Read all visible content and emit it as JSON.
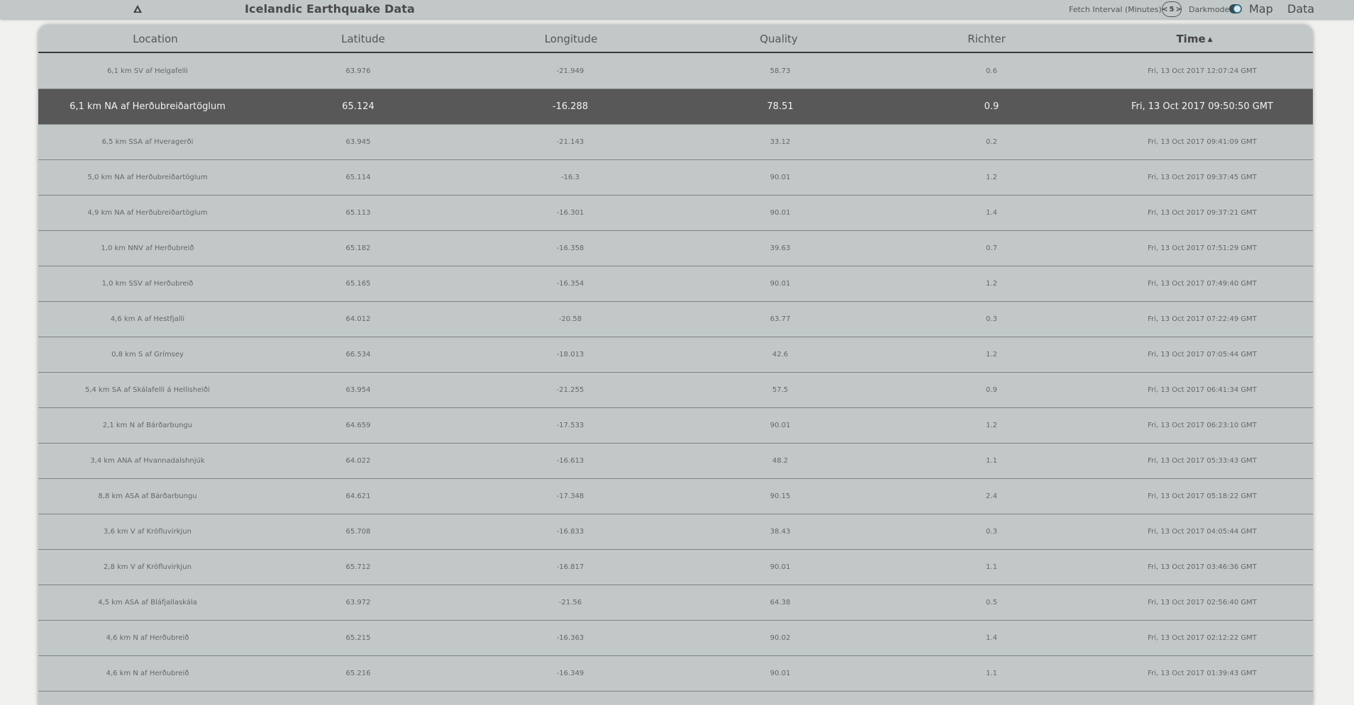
{
  "header": {
    "logo_icon": "warning-triangle-icon",
    "title": "Icelandic Earthquake Data",
    "fetch_interval_label": "Fetch Interval (Minutes)",
    "fetch_interval_value": "5",
    "fetch_interval_decrement": "<",
    "fetch_interval_increment": ">",
    "darkmode_label": "Darkmode",
    "darkmode_on": true,
    "nav_map": "Map",
    "nav_data": "Data"
  },
  "table": {
    "columns": [
      "Location",
      "Latitude",
      "Longitude",
      "Quality",
      "Richter",
      "Time"
    ],
    "sorted_column": "Time",
    "sort_direction": "ascending",
    "selected_row_index": 1,
    "rows": [
      [
        "6,1 km SV af Helgafelli",
        "63.976",
        "-21.949",
        "58.73",
        "0.6",
        "Fri, 13 Oct 2017 12:07:24 GMT"
      ],
      [
        "6,1 km NA af Herðubreiðartöglum",
        "65.124",
        "-16.288",
        "78.51",
        "0.9",
        "Fri, 13 Oct 2017 09:50:50 GMT"
      ],
      [
        "6,5 km SSA af Hveragerði",
        "63.945",
        "-21.143",
        "33.12",
        "0.2",
        "Fri, 13 Oct 2017 09:41:09 GMT"
      ],
      [
        "5,0 km NA af Herðubreiðartöglum",
        "65.114",
        "-16.3",
        "90.01",
        "1.2",
        "Fri, 13 Oct 2017 09:37:45 GMT"
      ],
      [
        "4,9 km NA af Herðubreiðartöglum",
        "65.113",
        "-16.301",
        "90.01",
        "1.4",
        "Fri, 13 Oct 2017 09:37:21 GMT"
      ],
      [
        "1,0 km NNV af Herðubreið",
        "65.182",
        "-16.358",
        "39.63",
        "0.7",
        "Fri, 13 Oct 2017 07:51:29 GMT"
      ],
      [
        "1,0 km SSV af Herðubreið",
        "65.165",
        "-16.354",
        "90.01",
        "1.2",
        "Fri, 13 Oct 2017 07:49:40 GMT"
      ],
      [
        "4,6 km A af Hestfjalli",
        "64.012",
        "-20.58",
        "63.77",
        "0.3",
        "Fri, 13 Oct 2017 07:22:49 GMT"
      ],
      [
        "0,8 km S af Grímsey",
        "66.534",
        "-18.013",
        "42.6",
        "1.2",
        "Fri, 13 Oct 2017 07:05:44 GMT"
      ],
      [
        "5,4 km SA af Skálafelli á Hellisheiði",
        "63.954",
        "-21.255",
        "57.5",
        "0.9",
        "Fri, 13 Oct 2017 06:41:34 GMT"
      ],
      [
        "2,1 km N af Bárðarbungu",
        "64.659",
        "-17.533",
        "90.01",
        "1.2",
        "Fri, 13 Oct 2017 06:23:10 GMT"
      ],
      [
        "3,4 km ANA af Hvannadalshnjúk",
        "64.022",
        "-16.613",
        "48.2",
        "1.1",
        "Fri, 13 Oct 2017 05:33:43 GMT"
      ],
      [
        "8,8 km ASA af Bárðarbungu",
        "64.621",
        "-17.348",
        "90.15",
        "2.4",
        "Fri, 13 Oct 2017 05:18:22 GMT"
      ],
      [
        "3,6 km V af Kröfluvirkjun",
        "65.708",
        "-16.833",
        "38.43",
        "0.3",
        "Fri, 13 Oct 2017 04:05:44 GMT"
      ],
      [
        "2,8 km V af Kröfluvirkjun",
        "65.712",
        "-16.817",
        "90.01",
        "1.1",
        "Fri, 13 Oct 2017 03:46:36 GMT"
      ],
      [
        "4,5 km ASA af Bláfjallaskála",
        "63.972",
        "-21.56",
        "64.38",
        "0.5",
        "Fri, 13 Oct 2017 02:56:40 GMT"
      ],
      [
        "4,6 km N af Herðubreið",
        "65.215",
        "-16.363",
        "90.02",
        "1.4",
        "Fri, 13 Oct 2017 02:12:22 GMT"
      ],
      [
        "4,6 km N af Herðubreið",
        "65.216",
        "-16.349",
        "90.01",
        "1.1",
        "Fri, 13 Oct 2017 01:39:43 GMT"
      ]
    ]
  },
  "colors": {
    "topbar_bg": "#c2c8c8",
    "table_bg": "#c2c8c8",
    "selected_row_bg": "#585858",
    "page_bg": "#f0f0ef",
    "toggle_accent": "#2aa7d8"
  }
}
